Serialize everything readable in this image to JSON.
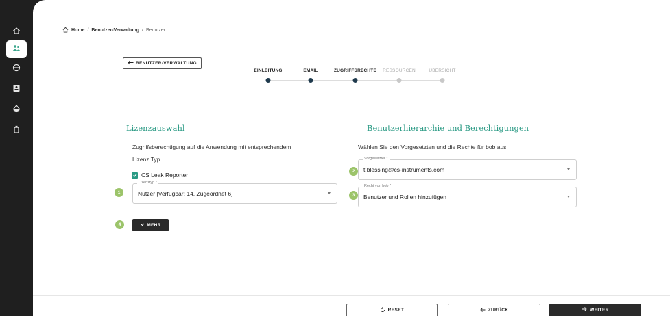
{
  "sidebar": {
    "items": [
      {
        "icon": "home-icon",
        "active": false
      },
      {
        "icon": "users-icon",
        "active": true
      },
      {
        "icon": "globe-icon",
        "active": false
      },
      {
        "icon": "id-card-icon",
        "active": false
      },
      {
        "icon": "drop-icon",
        "active": false
      },
      {
        "icon": "trash-icon",
        "active": false
      }
    ]
  },
  "breadcrumb": {
    "home": "Home",
    "section": "Benutzer-Verwaltung",
    "current": "Benutzer",
    "separator": "/"
  },
  "back_button": {
    "label": "BENUTZER-VERWALTUNG"
  },
  "stepper": {
    "steps": [
      {
        "label": "EINLEITUNG",
        "state": "done"
      },
      {
        "label": "EMAIL",
        "state": "done"
      },
      {
        "label": "ZUGRIFFSRECHTE",
        "state": "current"
      },
      {
        "label": "RESSOURCEN",
        "state": "inactive"
      },
      {
        "label": "ÜBERSICHT",
        "state": "inactive"
      }
    ]
  },
  "license": {
    "title": "Lizenzauswahl",
    "description_line1": "Zugriffsberechtigung auf die Anwendung mit entsprechendem",
    "description_line2": "Lizenz Typ",
    "checkbox_label": "CS Leak Reporter",
    "checkbox_checked": true,
    "field_label": "Lizenztyp *",
    "field_value": "Nutzer [Verfügbar: 14, Zugeordnet 6]",
    "badge": "1",
    "more_badge": "4",
    "more_label": "MEHR"
  },
  "hierarchy": {
    "title": "Benutzerhierarchie und Berechtigungen",
    "description": "Wählen Sie den Vorgesetzten und die Rechte für bob aus",
    "supervisor_label": "Vorgesetzter *",
    "supervisor_value": "t.blessing@cs-instruments.com",
    "supervisor_badge": "2",
    "rights_label": "Recht von bob *",
    "rights_value": "Benutzer und Rollen hinzufügen",
    "rights_badge": "3"
  },
  "footer": {
    "reset_label": "RESET",
    "back_label": "ZURÜCK",
    "next_label": "WEITER"
  },
  "colors": {
    "accent": "#2a9a84",
    "dark": "#2a2a2a",
    "badge": "#9cc46a",
    "step_active": "#1f3a4d",
    "step_inactive": "#c8c8c8"
  }
}
